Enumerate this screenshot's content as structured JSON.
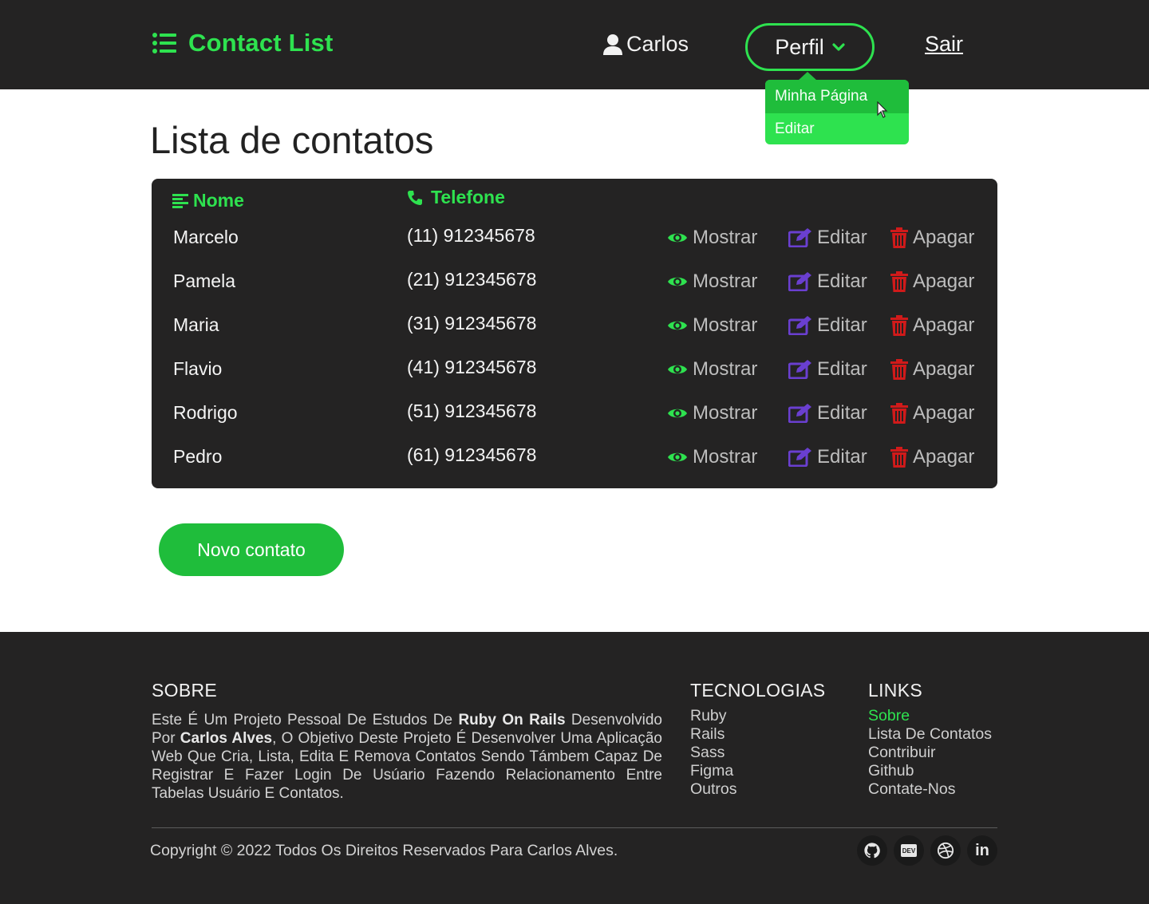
{
  "header": {
    "brand_title": "Contact List",
    "user_name": "Carlos",
    "profile_button": "Perfil",
    "logout_link": "Sair",
    "profile_menu": [
      {
        "label": "Minha Página",
        "active": true
      },
      {
        "label": "Editar",
        "active": false
      }
    ]
  },
  "main": {
    "title": "Lista de contatos",
    "table": {
      "columns": [
        "Nome",
        "Telefone"
      ],
      "rows": [
        {
          "name": "Marcelo",
          "phone": "(11) 912345678"
        },
        {
          "name": "Pamela",
          "phone": "(21) 912345678"
        },
        {
          "name": "Maria",
          "phone": "(31) 912345678"
        },
        {
          "name": "Flavio",
          "phone": "(41) 912345678"
        },
        {
          "name": "Rodrigo",
          "phone": "(51) 912345678"
        },
        {
          "name": "Pedro",
          "phone": "(61) 912345678"
        }
      ],
      "actions": {
        "show": "Mostrar",
        "edit": "Editar",
        "delete": "Apagar"
      }
    },
    "new_contact_button": "Novo contato"
  },
  "footer": {
    "about": {
      "heading": "SOBRE",
      "text_1": "Este É Um Projeto Pessoal De Estudos De ",
      "bold_1": "Ruby On Rails",
      "text_2": " Desenvolvido Por ",
      "bold_2": "Carlos Alves",
      "text_3": ", O Objetivo Deste Projeto É Desenvolver Uma Aplicação Web Que Cria, Lista, Edita E Remova Contatos Sendo Támbem Capaz De Registrar E Fazer Login De Usúario Fazendo Relacionamento Entre Tabelas Usuário E Contatos."
    },
    "technologies": {
      "heading": "TECNOLOGIAS",
      "items": [
        "Ruby",
        "Rails",
        "Sass",
        "Figma",
        "Outros"
      ]
    },
    "links": {
      "heading": "LINKS",
      "items": [
        "Sobre",
        "Lista De Contatos",
        "Contribuir",
        "Github",
        "Contate-Nos"
      ]
    },
    "copyright": "Copyright © 2022 Todos Os Direitos Reservados Para Carlos Alves.",
    "social": [
      "github-icon",
      "dev-icon",
      "dribbble-icon",
      "linkedin-icon"
    ],
    "dev_icon_text": "DEV",
    "linkedin_icon_text": "in"
  },
  "colors": {
    "accent_green": "#2ee24f",
    "button_green": "#1fbd3b",
    "dark_bg": "#242323",
    "edit_purple": "#6a3fd0",
    "delete_red": "#d11a1a",
    "action_text": "#bdbdbd"
  }
}
